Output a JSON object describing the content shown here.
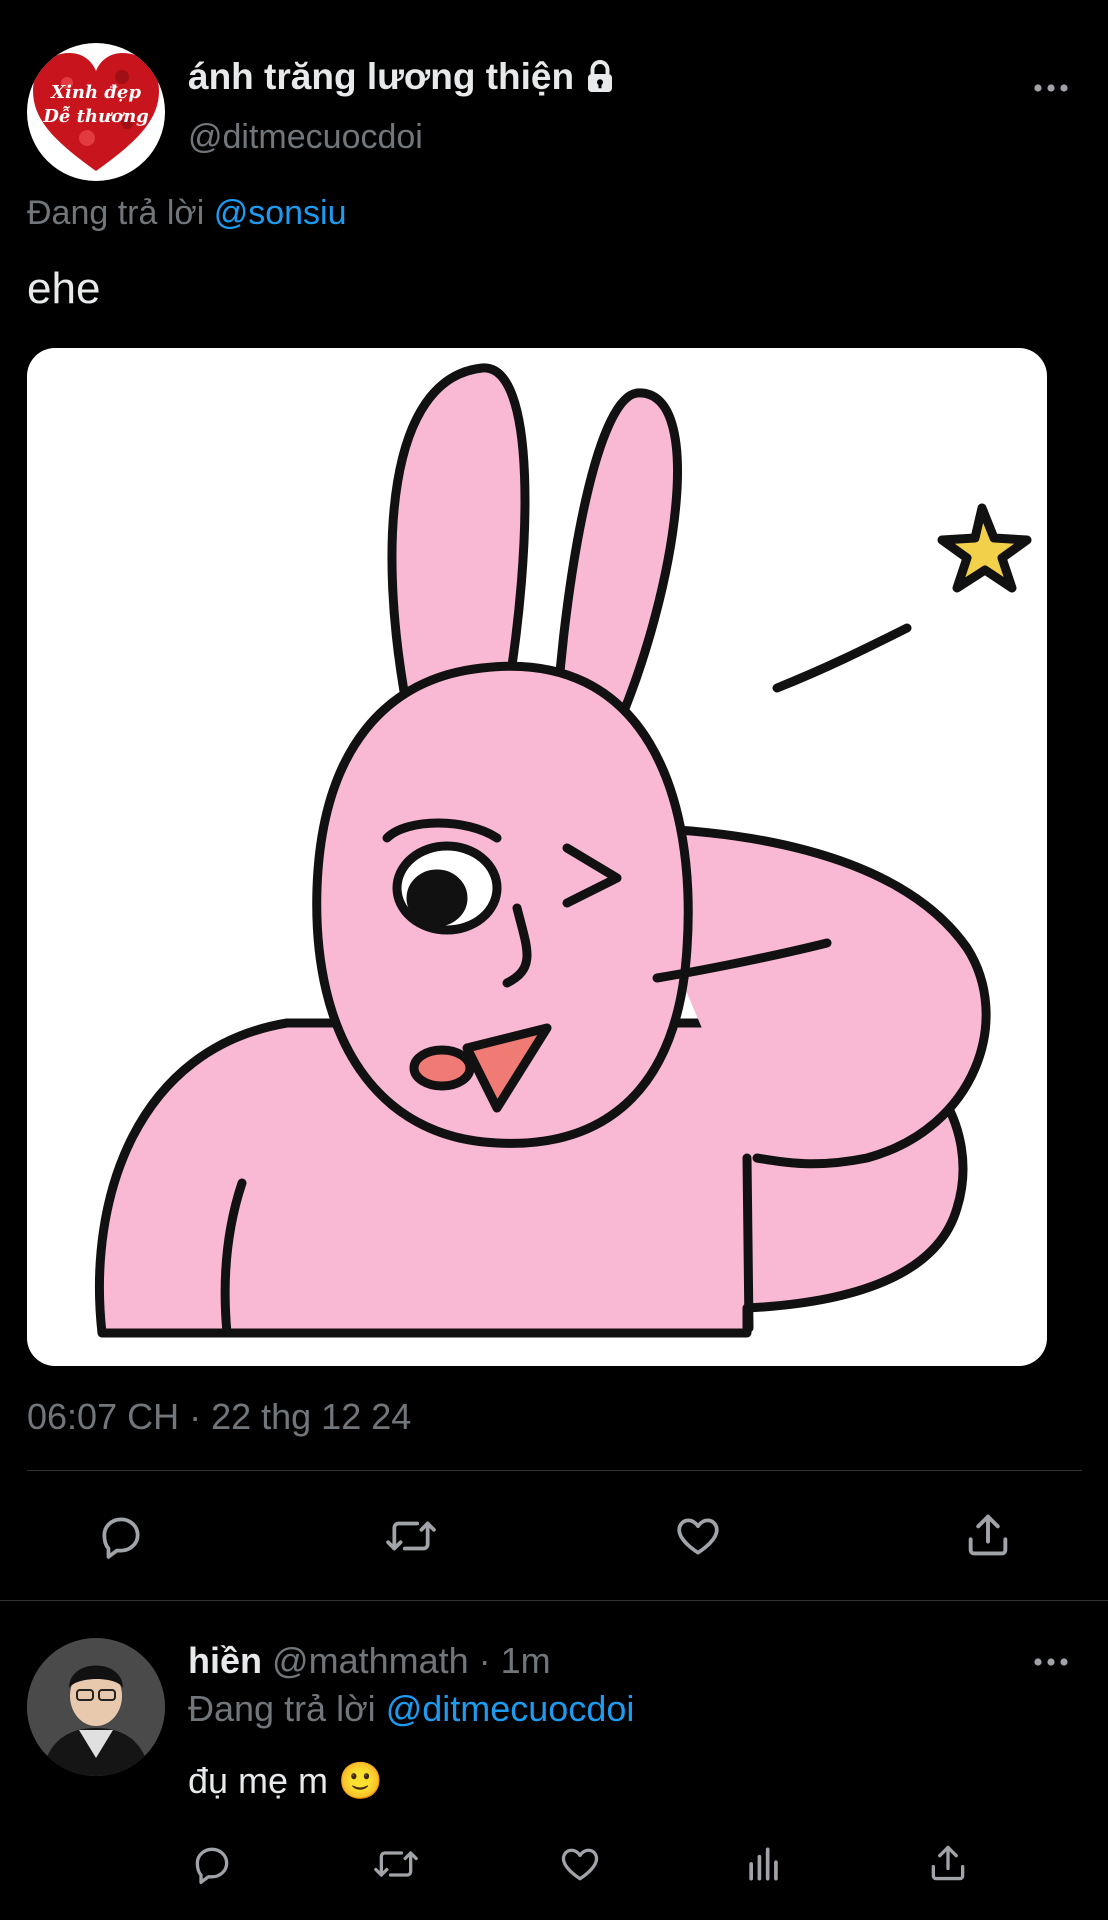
{
  "main_tweet": {
    "display_name": "ánh trăng lương thiện",
    "handle": "@ditmecuocdoi",
    "avatar_text_line1": "Xinh đẹp",
    "avatar_text_line2": "Dễ thương",
    "reply_prefix": "Đang trả lời",
    "reply_to": "@sonsiu",
    "text": "ehe",
    "timestamp": "06:07 CH · 22 thg 12 24",
    "icons": {
      "more": "more-horizontal-icon",
      "lock": "lock-icon",
      "reply": "reply-icon",
      "retweet": "retweet-icon",
      "like": "heart-icon",
      "share": "share-icon"
    }
  },
  "reply_tweet": {
    "display_name": "hiền",
    "handle": "@mathmath",
    "time": "· 1m",
    "reply_prefix": "Đang trả lời",
    "reply_to": "@ditmecuocdoi",
    "text": "đụ mẹ m 🙂",
    "icons": {
      "more": "more-horizontal-icon",
      "reply": "reply-icon",
      "retweet": "retweet-icon",
      "like": "heart-icon",
      "views": "bar-chart-icon",
      "share": "share-icon"
    }
  },
  "colors": {
    "background": "#000000",
    "text": "#e7e9ea",
    "muted": "#71767b",
    "accent": "#1d9bf0",
    "divider": "#2f3336",
    "bunny_pink": "#f9b8d3",
    "star_yellow": "#f2d04a"
  }
}
